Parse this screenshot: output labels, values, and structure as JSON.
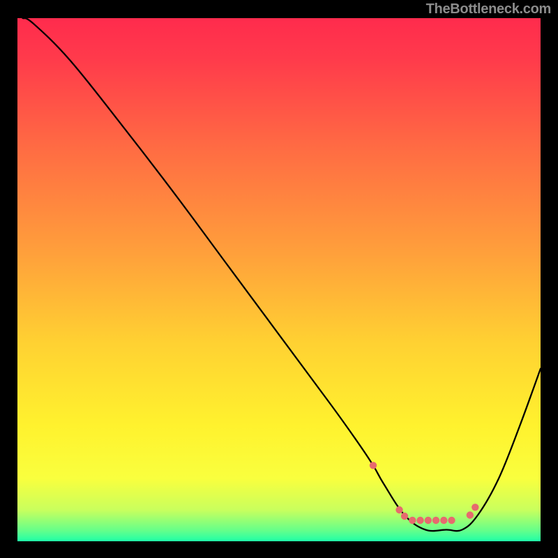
{
  "attribution": "TheBottleneck.com",
  "colors": {
    "gradient": [
      {
        "offset": "0%",
        "color": "#ff2b4d"
      },
      {
        "offset": "8%",
        "color": "#ff3b4b"
      },
      {
        "offset": "25%",
        "color": "#ff6c43"
      },
      {
        "offset": "45%",
        "color": "#ffa03b"
      },
      {
        "offset": "62%",
        "color": "#ffd132"
      },
      {
        "offset": "78%",
        "color": "#fff22e"
      },
      {
        "offset": "88%",
        "color": "#f9ff3e"
      },
      {
        "offset": "94%",
        "color": "#c9ff5d"
      },
      {
        "offset": "98%",
        "color": "#63ff8b"
      },
      {
        "offset": "100%",
        "color": "#1fffa8"
      }
    ],
    "marker": "#e66a6e",
    "curve": "#000000"
  },
  "chart_data": {
    "type": "line",
    "title": "",
    "xlabel": "",
    "ylabel": "",
    "xlim": [
      0,
      100
    ],
    "ylim": [
      0,
      100
    ],
    "series": [
      {
        "name": "bottleneck-curve",
        "x": [
          1,
          3,
          10,
          20,
          30,
          40,
          50,
          60,
          65,
          68,
          70,
          74,
          78,
          82,
          85,
          88,
          92,
          96,
          100
        ],
        "y": [
          100,
          99,
          92,
          79.5,
          66.5,
          53,
          39.5,
          26,
          19,
          14.5,
          11,
          5,
          2.2,
          2.2,
          2.2,
          5,
          12,
          22,
          33
        ]
      }
    ],
    "markers": {
      "name": "optimal-range",
      "color": "#e66a6e",
      "points": [
        {
          "x": 68,
          "y": 14.5
        },
        {
          "x": 73,
          "y": 6
        },
        {
          "x": 74,
          "y": 4.8
        },
        {
          "x": 75.5,
          "y": 4
        },
        {
          "x": 77,
          "y": 4
        },
        {
          "x": 78.5,
          "y": 4
        },
        {
          "x": 80,
          "y": 4
        },
        {
          "x": 81.5,
          "y": 4
        },
        {
          "x": 83,
          "y": 4
        },
        {
          "x": 86.5,
          "y": 5
        },
        {
          "x": 87.5,
          "y": 6.5
        }
      ]
    }
  }
}
